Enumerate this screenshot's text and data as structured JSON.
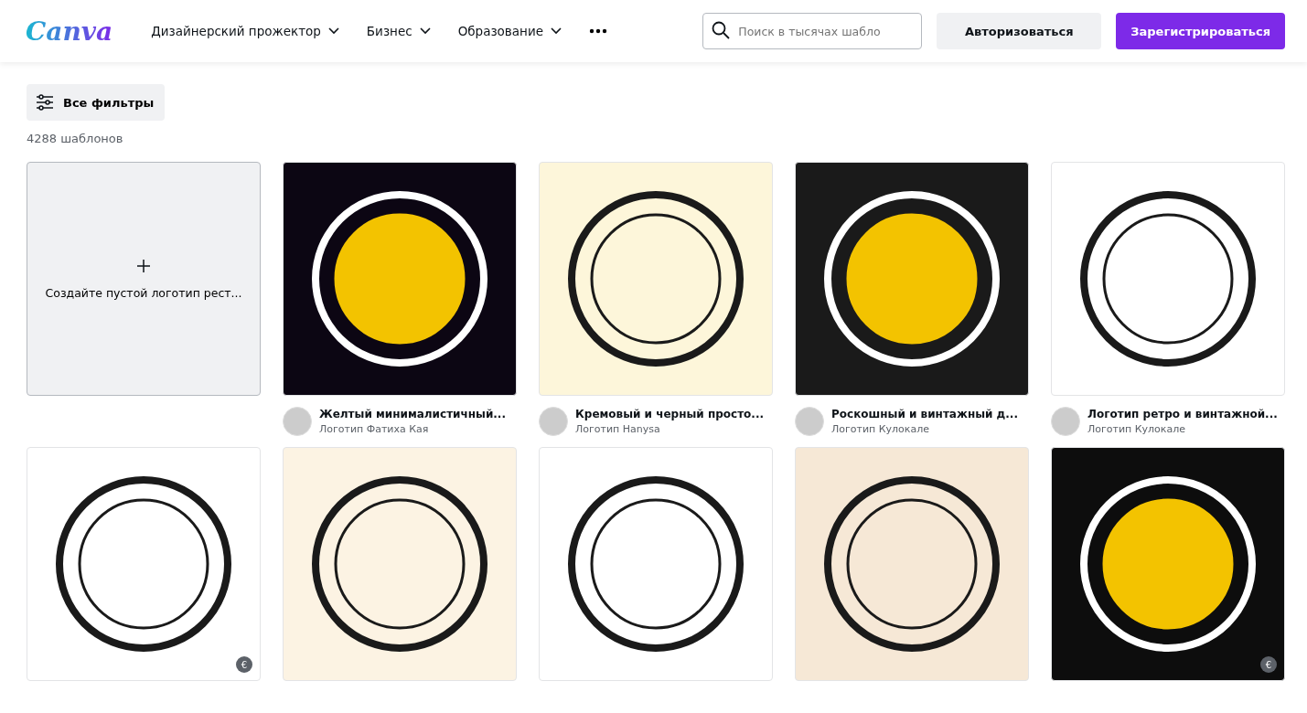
{
  "header": {
    "logo": "Canva",
    "nav": [
      {
        "label": "Дизайнерский прожектор",
        "caret": true
      },
      {
        "label": "Бизнес",
        "caret": true
      },
      {
        "label": "Образование",
        "caret": true
      }
    ],
    "search": {
      "placeholder": "Поиск в тысячах шабло"
    },
    "login": "Авторизоваться",
    "signup": "Зарегистрироваться"
  },
  "filters": {
    "label": "Все фильтры",
    "count": "4288 шаблонов"
  },
  "create_card": {
    "label": "Создайте пустой логотип рест..."
  },
  "templates": [
    {
      "title": "Желтый минималистичный...",
      "author": "Логотип Фатиха Кая",
      "color": "#0c0613"
    },
    {
      "title": "Кремовый и черный просто...",
      "author": "Логотип Hanysa",
      "color": "#fdf6da"
    },
    {
      "title": "Роскошный и винтажный д...",
      "author": "Логотип Кулокале",
      "color": "#1a1a1a"
    },
    {
      "title": "Логотип ретро и винтажной...",
      "author": "Логотип Кулокале",
      "color": "#ffffff"
    },
    {
      "color": "#ffffff",
      "badge": "€"
    },
    {
      "color": "#fcf3e3"
    },
    {
      "color": "#ffffff"
    },
    {
      "color": "#f6e8d6"
    },
    {
      "color": "#0d0d0d",
      "badge": "€"
    }
  ]
}
